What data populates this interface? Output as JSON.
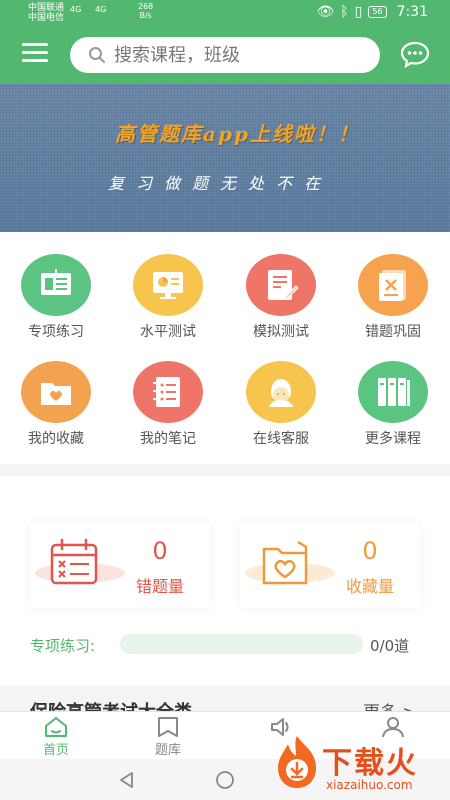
{
  "status_bar": {
    "carrier1": "中国联通",
    "carrier2": "中国电信",
    "net1": "4G",
    "net2": "4G",
    "speed_value": "268",
    "speed_unit": "B/s",
    "battery": "56",
    "time": "7:31"
  },
  "header": {
    "search_placeholder": "搜索课程，班级"
  },
  "banner": {
    "title": "高管题库app上线啦！！",
    "subtitle": "复习做题无处不在"
  },
  "grid": [
    {
      "label": "专项练习",
      "color": "#5cc482",
      "icon": "board-icon"
    },
    {
      "label": "水平测试",
      "color": "#f7c44e",
      "icon": "monitor-chart-icon"
    },
    {
      "label": "模拟测试",
      "color": "#ee7568",
      "icon": "document-edit-icon"
    },
    {
      "label": "错题巩固",
      "color": "#f6a24f",
      "icon": "wrong-paper-icon"
    },
    {
      "label": "我的收藏",
      "color": "#f3a350",
      "icon": "folder-heart-icon"
    },
    {
      "label": "我的笔记",
      "color": "#ee7568",
      "icon": "notebook-icon"
    },
    {
      "label": "在线客服",
      "color": "#f7c44e",
      "icon": "customer-service-icon"
    },
    {
      "label": "更多课程",
      "color": "#5cc482",
      "icon": "books-icon"
    }
  ],
  "stats": {
    "wrong": {
      "count": "0",
      "label": "错题量",
      "color": "#e0564a"
    },
    "favorite": {
      "count": "0",
      "label": "收藏量",
      "color": "#ef9a3a"
    }
  },
  "progress": {
    "label": "专项练习:",
    "count": "0/0道",
    "fraction": 0.0
  },
  "section": {
    "title": "保险高管考试大全类",
    "more": "更多 >"
  },
  "tabs": [
    {
      "label": "首页",
      "icon": "home-icon",
      "active": true
    },
    {
      "label": "题库",
      "icon": "question-bank-icon",
      "active": false
    },
    {
      "label": "",
      "icon": "speaker-icon",
      "active": false
    },
    {
      "label": "",
      "icon": "user-icon",
      "active": false
    }
  ],
  "watermark": {
    "text": "下载火",
    "domain": "xiazaihuo.com"
  },
  "colors": {
    "primary": "#53b86f"
  }
}
